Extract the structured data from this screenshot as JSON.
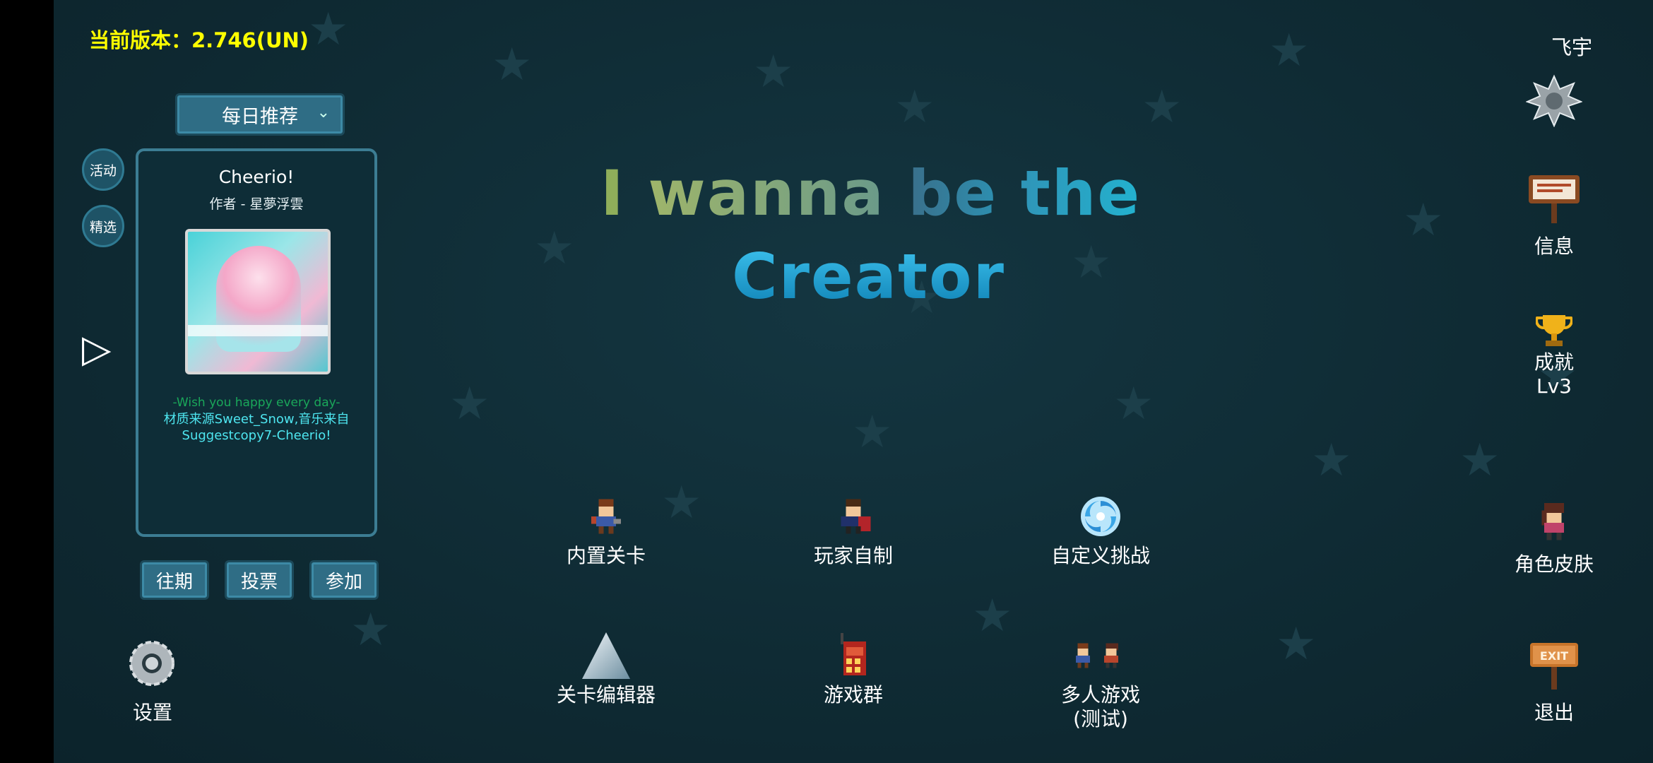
{
  "version_label": "当前版本：2.746(UN)",
  "username": "飞宇",
  "dropdown": {
    "selected": "每日推荐"
  },
  "side_buttons": {
    "activity": "活动",
    "featured": "精选"
  },
  "card": {
    "title": "Cheerio!",
    "author": "作者 - 星夢浮雲",
    "desc_line1": "-Wish you happy every day-",
    "desc_line2": "材质来源Sweet_Snow,音乐来自Suggestcopy7-Cheerio!"
  },
  "card_buttons": {
    "past": "往期",
    "vote": "投票",
    "join": "参加"
  },
  "title_line1": {
    "i": "I",
    "wanna": "wanna",
    "be": "be",
    "the": "the"
  },
  "title_line2": "Creator",
  "menu": {
    "builtin": "内置关卡",
    "player_made": "玩家自制",
    "custom_challenge": "自定义挑战",
    "editor": "关卡编辑器",
    "group": "游戏群",
    "multiplayer_1": "多人游戏",
    "multiplayer_2": "(测试)"
  },
  "right": {
    "info": "信息",
    "achievement": "成就",
    "level": "Lv3",
    "skin": "角色皮肤",
    "exit": "退出",
    "exit_sign_text": "EXIT"
  },
  "settings": "设置",
  "colors": {
    "version": "#ffff00",
    "button": "#2f6d85",
    "desc_green": "#1aa85a",
    "desc_cyan": "#4ee6f0"
  }
}
